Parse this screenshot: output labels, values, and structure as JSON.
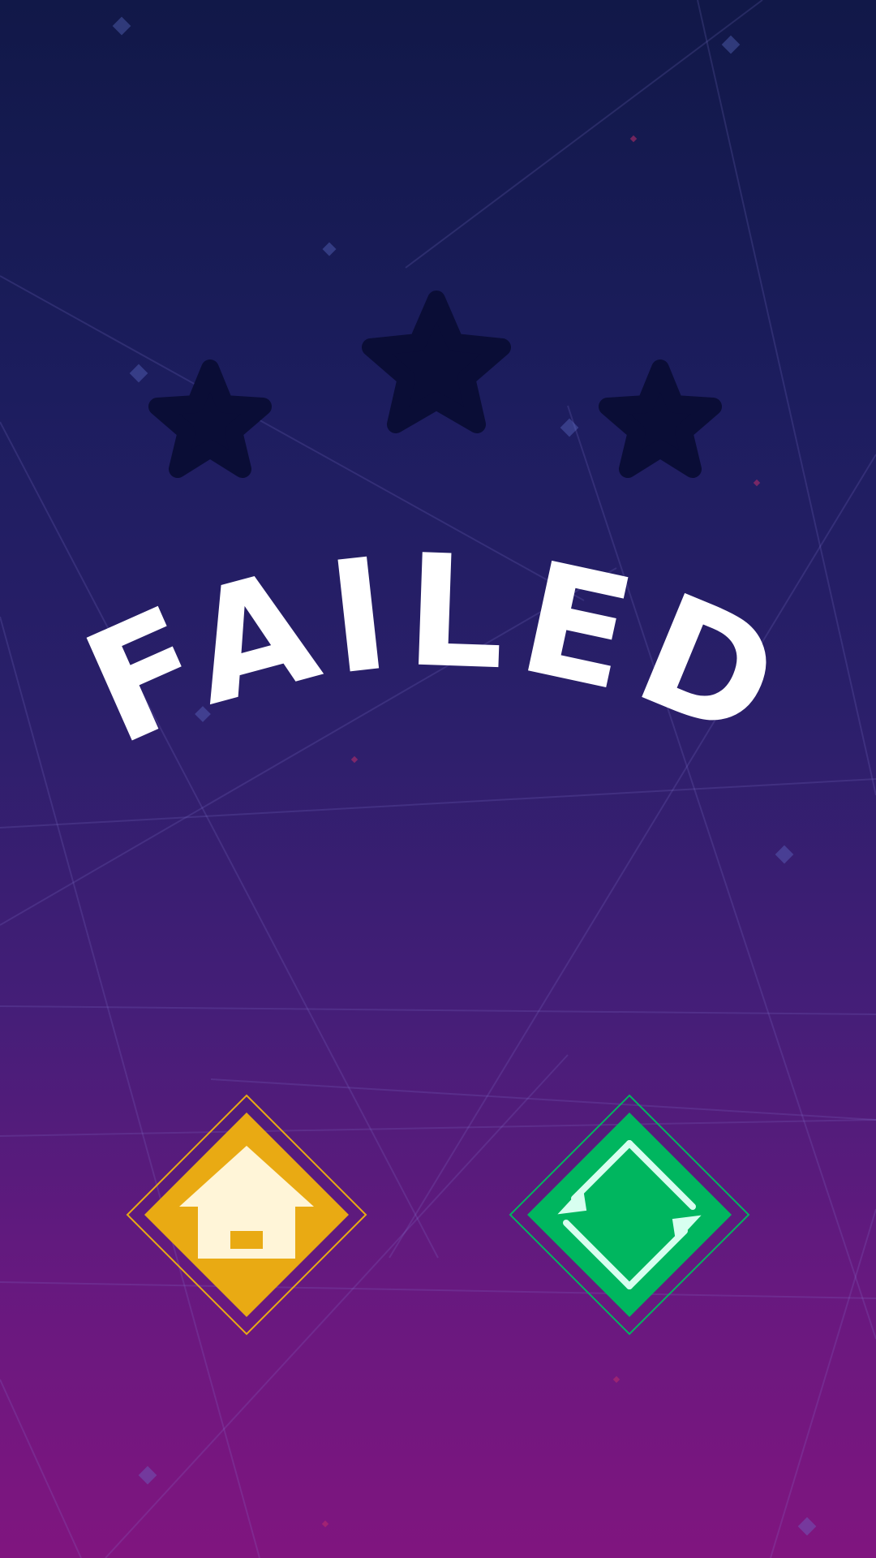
{
  "screen": {
    "title": "FAILED",
    "stars_earned": 0,
    "stars_total": 3
  },
  "buttons": {
    "home": {
      "icon": "home-icon",
      "color": "#e9aa13",
      "icon_color": "#fff5d8"
    },
    "retry": {
      "icon": "retry-icon",
      "color": "#00b65f",
      "icon_color": "#d8fff0"
    }
  },
  "colors": {
    "star_empty": "#0a0d36",
    "background_top": "#111848",
    "background_bottom": "#80157f"
  }
}
